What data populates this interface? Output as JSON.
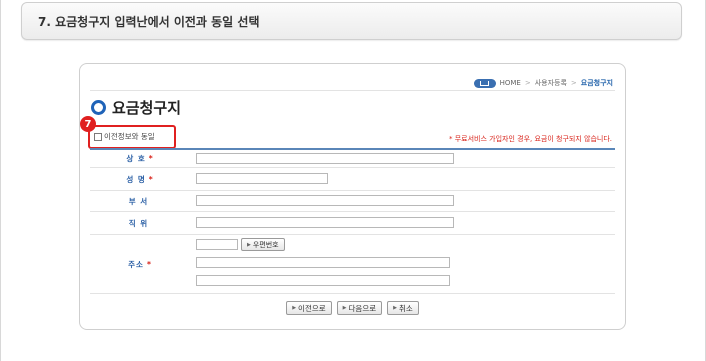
{
  "step": {
    "title": "7. 요금청구지 입력난에서 이전과 동일 선택"
  },
  "breadcrumb": {
    "home": "HOME",
    "sep1": ">",
    "item1": "사용자등록",
    "sep2": ">",
    "current": "요금청구지"
  },
  "page": {
    "title": "요금청구지"
  },
  "copy_option": {
    "label": "이전정보와 동일",
    "checked": false,
    "badge": "7"
  },
  "notice": "* 무료서비스 가입자인 경우, 요금이 청구되지 않습니다.",
  "form": {
    "rows": [
      {
        "label": "상 호",
        "required": "*",
        "value": ""
      },
      {
        "label": "성 명",
        "required": "*",
        "value": ""
      },
      {
        "label": "부 서",
        "required": "",
        "value": ""
      },
      {
        "label": "직 위",
        "required": "",
        "value": ""
      },
      {
        "label": "주소",
        "required": "*",
        "zipcode": "",
        "address1": "",
        "address2": ""
      }
    ],
    "zip_button": "우편번호"
  },
  "buttons": {
    "prev": "이전으로",
    "next": "다음으로",
    "cancel": "취소"
  },
  "colors": {
    "accent": "#1f63b8",
    "required": "#d8231a",
    "highlight": "#e02020"
  },
  "icons": [
    "home-icon",
    "circle-title-icon",
    "arrow-icon"
  ]
}
